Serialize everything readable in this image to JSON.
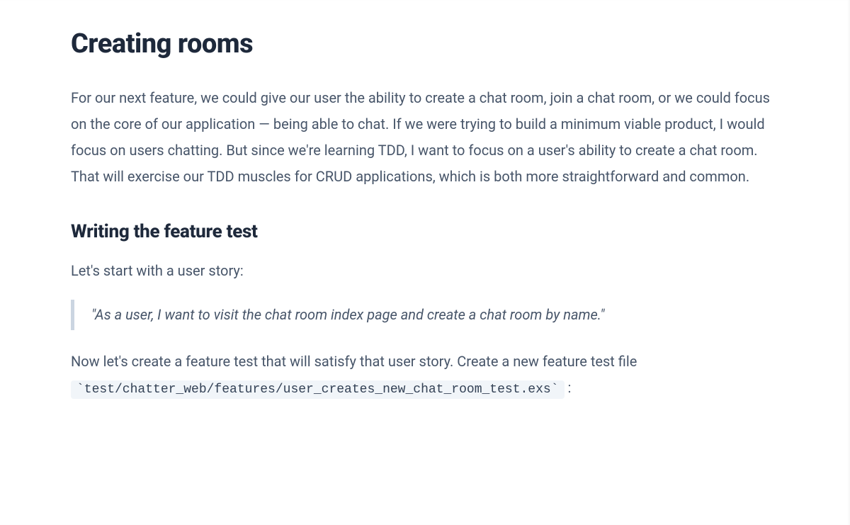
{
  "title": "Creating rooms",
  "intro_paragraph": "For our next feature, we could give our user the ability to create a chat room, join a chat room, or we could focus on the core of our application — being able to chat. If we were trying to build a minimum viable product, I would focus on users chatting. But since we're learning TDD, I want to focus on a user's ability to create a chat room. That will exercise our TDD muscles for CRUD applications, which is both more straightforward and common.",
  "section2_title": "Writing the feature test",
  "section2_intro": "Let's start with a user story:",
  "user_story_quote": "\"As a user, I want to visit the chat room index page and create a chat room by name.\"",
  "post_quote_text_before_code": "Now let's create a feature test that will satisfy that user story. Create a new feature test file ",
  "feature_test_path": "`test/chatter_web/features/user_creates_new_chat_room_test.exs`",
  "post_quote_text_after_code": " :"
}
